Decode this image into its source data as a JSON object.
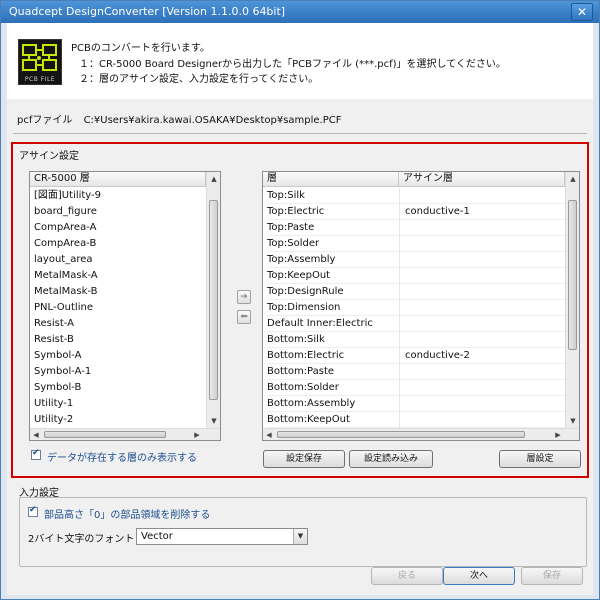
{
  "window": {
    "title": "Quadcept DesignConverter [Version 1.1.0.0 64bit]"
  },
  "header": {
    "logo_text": "PCB FILE",
    "line1": "PCBのコンバートを行います。",
    "line2": "１：CR-5000 Board Designerから出力した「PCBファイル (***.pcf)」を選択してください。",
    "line3": "２：層のアサイン設定、入力設定を行ってください。"
  },
  "pcf": {
    "label": "pcfファイル",
    "path": "C:¥Users¥akira.kawai.OSAKA¥Desktop¥sample.PCF"
  },
  "assign": {
    "title": "アサイン設定",
    "left_header": "CR-5000 層",
    "left_items": [
      "[図面]Utility-9",
      "board_figure",
      "CompArea-A",
      "CompArea-B",
      "layout_area",
      "MetalMask-A",
      "MetalMask-B",
      "PNL-Outline",
      "Resist-A",
      "Resist-B",
      "Symbol-A",
      "Symbol-A-1",
      "Symbol-B",
      "Utility-1",
      "Utility-2"
    ],
    "right_header_layer": "層",
    "right_header_assign": "アサイン層",
    "right_rows": [
      {
        "layer": "Top:Silk",
        "assign": ""
      },
      {
        "layer": "Top:Electric",
        "assign": "conductive-1"
      },
      {
        "layer": "Top:Paste",
        "assign": ""
      },
      {
        "layer": "Top:Solder",
        "assign": ""
      },
      {
        "layer": "Top:Assembly",
        "assign": ""
      },
      {
        "layer": "Top:KeepOut",
        "assign": ""
      },
      {
        "layer": "Top:DesignRule",
        "assign": ""
      },
      {
        "layer": "Top:Dimension",
        "assign": ""
      },
      {
        "layer": "Default Inner:Electric",
        "assign": ""
      },
      {
        "layer": "Bottom:Silk",
        "assign": ""
      },
      {
        "layer": "Bottom:Electric",
        "assign": "conductive-2"
      },
      {
        "layer": "Bottom:Paste",
        "assign": ""
      },
      {
        "layer": "Bottom:Solder",
        "assign": ""
      },
      {
        "layer": "Bottom:Assembly",
        "assign": ""
      },
      {
        "layer": "Bottom:KeepOut",
        "assign": ""
      }
    ],
    "show_existing_label": "データが存在する層のみ表示する",
    "save_settings": "設定保存",
    "load_settings": "設定読み込み",
    "layer_settings": "層設定"
  },
  "input": {
    "title": "入力設定",
    "delete_zero_label": "部品高さ「0」の部品領域を削除する",
    "font_label": "2バイト文字のフォント",
    "font_value": "Vector"
  },
  "footer": {
    "back": "戻る",
    "next": "次へ",
    "save": "保存"
  },
  "colors": {
    "highlight_border": "#d40000",
    "titlebar": "#2c6fb8",
    "check_label": "#1d4e8f"
  }
}
